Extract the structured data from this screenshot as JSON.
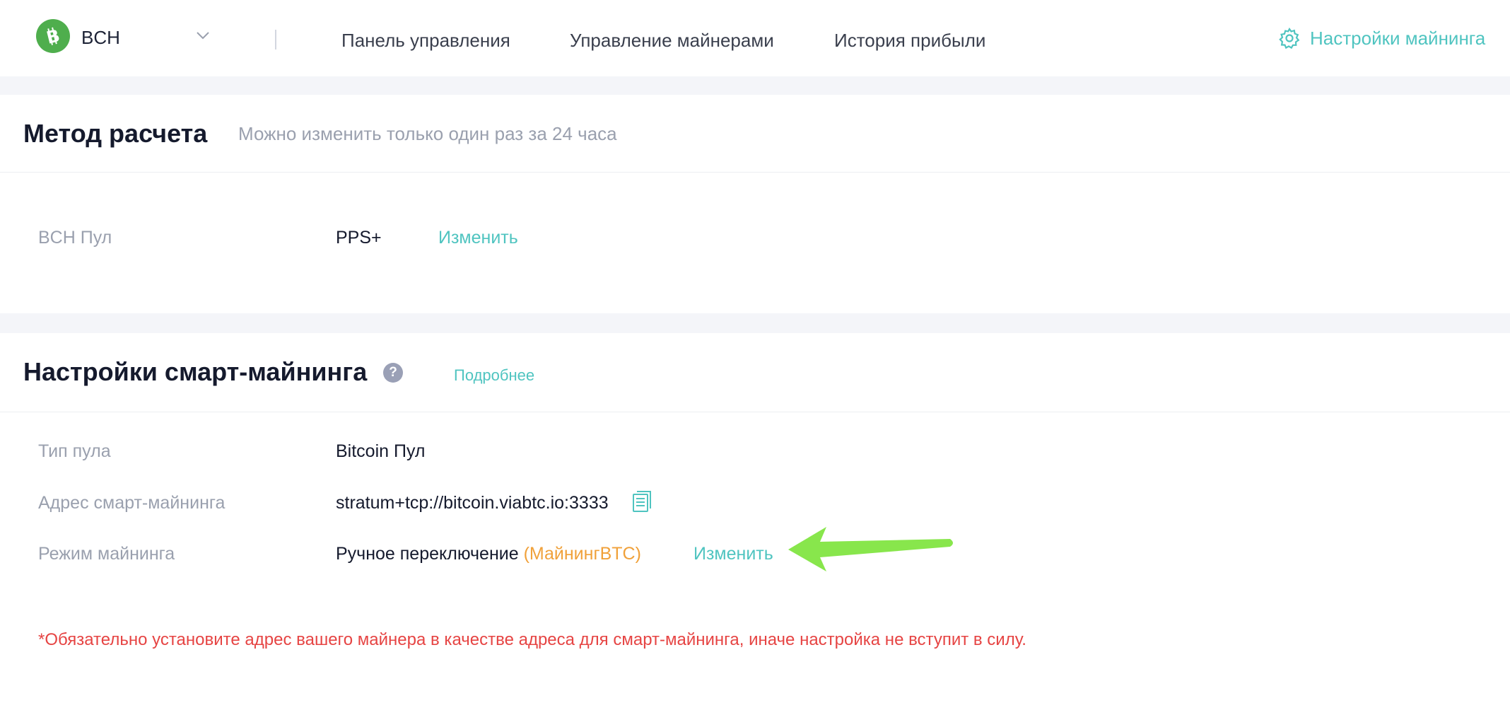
{
  "header": {
    "coin": "BCH",
    "nav": [
      "Панель управления",
      "Управление майнерами",
      "История прибыли"
    ],
    "settings_label": "Настройки майнинга"
  },
  "settlement": {
    "title": "Метод расчета",
    "subtitle": "Можно изменить только один раз за 24 часа",
    "row_label": "BCH Пул",
    "row_value": "PPS+",
    "change_label": "Изменить"
  },
  "smart": {
    "title": "Настройки смарт-майнинга",
    "help_glyph": "?",
    "more_label": "Подробнее",
    "rows": [
      {
        "label": "Тип пула",
        "value": "Bitcoin Пул"
      },
      {
        "label": "Адрес смарт-майнинга",
        "value": "stratum+tcp://bitcoin.viabtc.io:3333"
      },
      {
        "label": "Режим майнинга",
        "value": "Ручное переключение",
        "note": "(МайнингBTC)"
      }
    ],
    "change_label": "Изменить",
    "warning": "*Обязательно установите адрес вашего майнера в качестве адреса для смарт-майнинга, иначе настройка не вступит в силу."
  },
  "icons": {
    "coin_logo": "bitcoin-cash-logo",
    "chevron": "chevron-down-icon",
    "settings": "gear-icon",
    "copy": "copy-icon",
    "help": "question-icon",
    "annotation": "green-arrow"
  },
  "colors": {
    "accent": "#4fc4c0",
    "coin": "#4fae4d",
    "warning": "#e64443",
    "note": "#f0a13a",
    "arrow": "#88e64c"
  }
}
